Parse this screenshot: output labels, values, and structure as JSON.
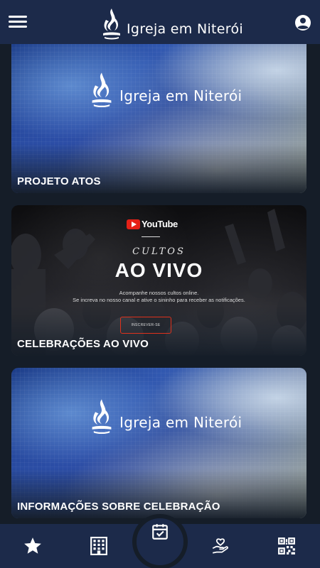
{
  "header": {
    "title": "Igreja em Niterói",
    "menu_icon": "hamburger-menu-icon",
    "account_icon": "account-circle-icon"
  },
  "cards": [
    {
      "title": "PROJETO ATOS",
      "logo_text": "Igreja em Niterói"
    },
    {
      "title": "CELEBRAÇÕES AO VIVO",
      "youtube_label": "YouTube",
      "cultos": "CULTOS",
      "headline": "AO VIVO",
      "line1": "Acompanhe nossos cultos online.",
      "line2": "Se increva no nosso canal e ative o sininho para receber as notificações.",
      "subscribe_label": "INSCREVER-SE"
    },
    {
      "title": "INFORMAÇÕES SOBRE CELEBRAÇÃO",
      "logo_text": "Igreja em Niterói"
    }
  ],
  "bottom_nav": {
    "items": [
      "star-icon",
      "building-icon",
      "calendar-check-icon",
      "hand-heart-icon",
      "qr-code-icon"
    ]
  },
  "colors": {
    "bar": "#1c2a4a",
    "background": "#151d28",
    "youtube_red": "#e62117"
  }
}
